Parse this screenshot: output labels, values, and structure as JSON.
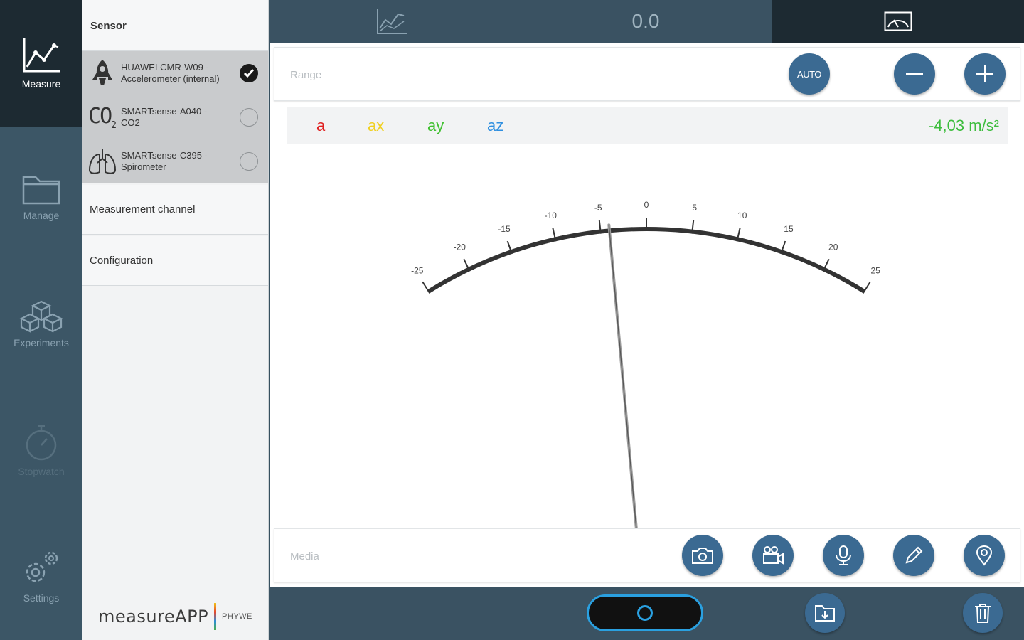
{
  "nav": {
    "items": [
      {
        "label": "Measure",
        "icon": "line-chart-icon",
        "active": true
      },
      {
        "label": "Manage",
        "icon": "folder-icon"
      },
      {
        "label": "Experiments",
        "icon": "cubes-icon"
      },
      {
        "label": "Stopwatch",
        "icon": "stopwatch-icon",
        "disabled": true
      },
      {
        "label": "Settings",
        "icon": "gears-icon"
      }
    ]
  },
  "sensor_panel": {
    "title": "Sensor",
    "sensors": [
      {
        "name": "HUAWEI CMR-W09 - Accelerometer (internal)",
        "icon": "rocket-icon",
        "selected": true
      },
      {
        "name": "SMARTsense-A040 - CO2",
        "icon_text": "CO",
        "icon_sub": "2",
        "selected": false
      },
      {
        "name": "SMARTsense-C395 - Spirometer",
        "icon": "lungs-icon",
        "selected": false
      }
    ],
    "links": [
      "Measurement channel",
      "Configuration"
    ],
    "brand": {
      "name": "measureAPP",
      "sub": "PHYWE"
    }
  },
  "topbar": {
    "value": "0.0",
    "tabs": [
      "chart-icon",
      "value",
      "gauge-icon"
    ],
    "active_tab": "gauge"
  },
  "range": {
    "label": "Range",
    "auto_label": "AUTO"
  },
  "channels": {
    "items": [
      {
        "label": "a",
        "color": "#e02020"
      },
      {
        "label": "ax",
        "color": "#f0d020"
      },
      {
        "label": "ay",
        "color": "#40c030"
      },
      {
        "label": "az",
        "color": "#2f8fe0"
      }
    ],
    "value": "-4,03 m/s²"
  },
  "gauge": {
    "min": -25,
    "max": 25,
    "value": -4.03,
    "ticks": [
      "-25",
      "-20",
      "-15",
      "-10",
      "-5",
      "0",
      "5",
      "10",
      "15",
      "20",
      "25"
    ]
  },
  "media": {
    "label": "Media",
    "buttons": [
      "camera-icon",
      "video-icon",
      "microphone-icon",
      "pencil-icon",
      "location-icon"
    ]
  },
  "bottombar": {
    "buttons": [
      "record-icon",
      "save-icon",
      "trash-icon"
    ]
  }
}
